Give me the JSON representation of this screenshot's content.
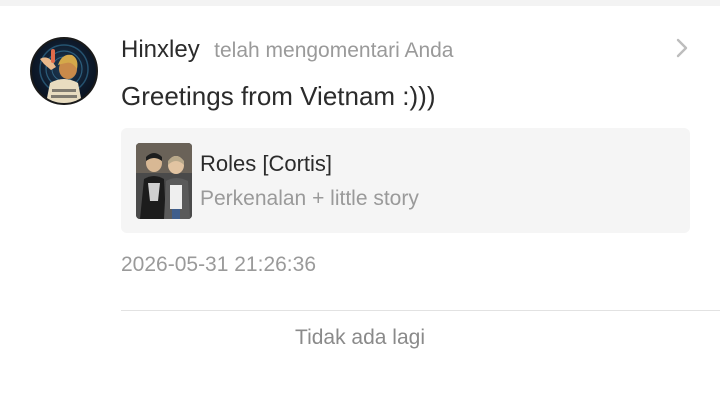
{
  "notification": {
    "avatar_icon": "user-avatar",
    "username": "Hinxley",
    "action": "telah mengomentari Anda",
    "comment": "Greetings from Vietnam :)))",
    "chevron_icon": "chevron-right-icon",
    "post": {
      "title": "Roles [Cortis]",
      "subtitle": "Perkenalan + little story"
    },
    "timestamp": "2026-05-31 21:26:36"
  },
  "footer": {
    "end_text": "Tidak ada lagi"
  },
  "colors": {
    "primary_text": "#2b2b2b",
    "secondary_text": "#9a9a9a",
    "card_background": "#f5f5f5"
  }
}
